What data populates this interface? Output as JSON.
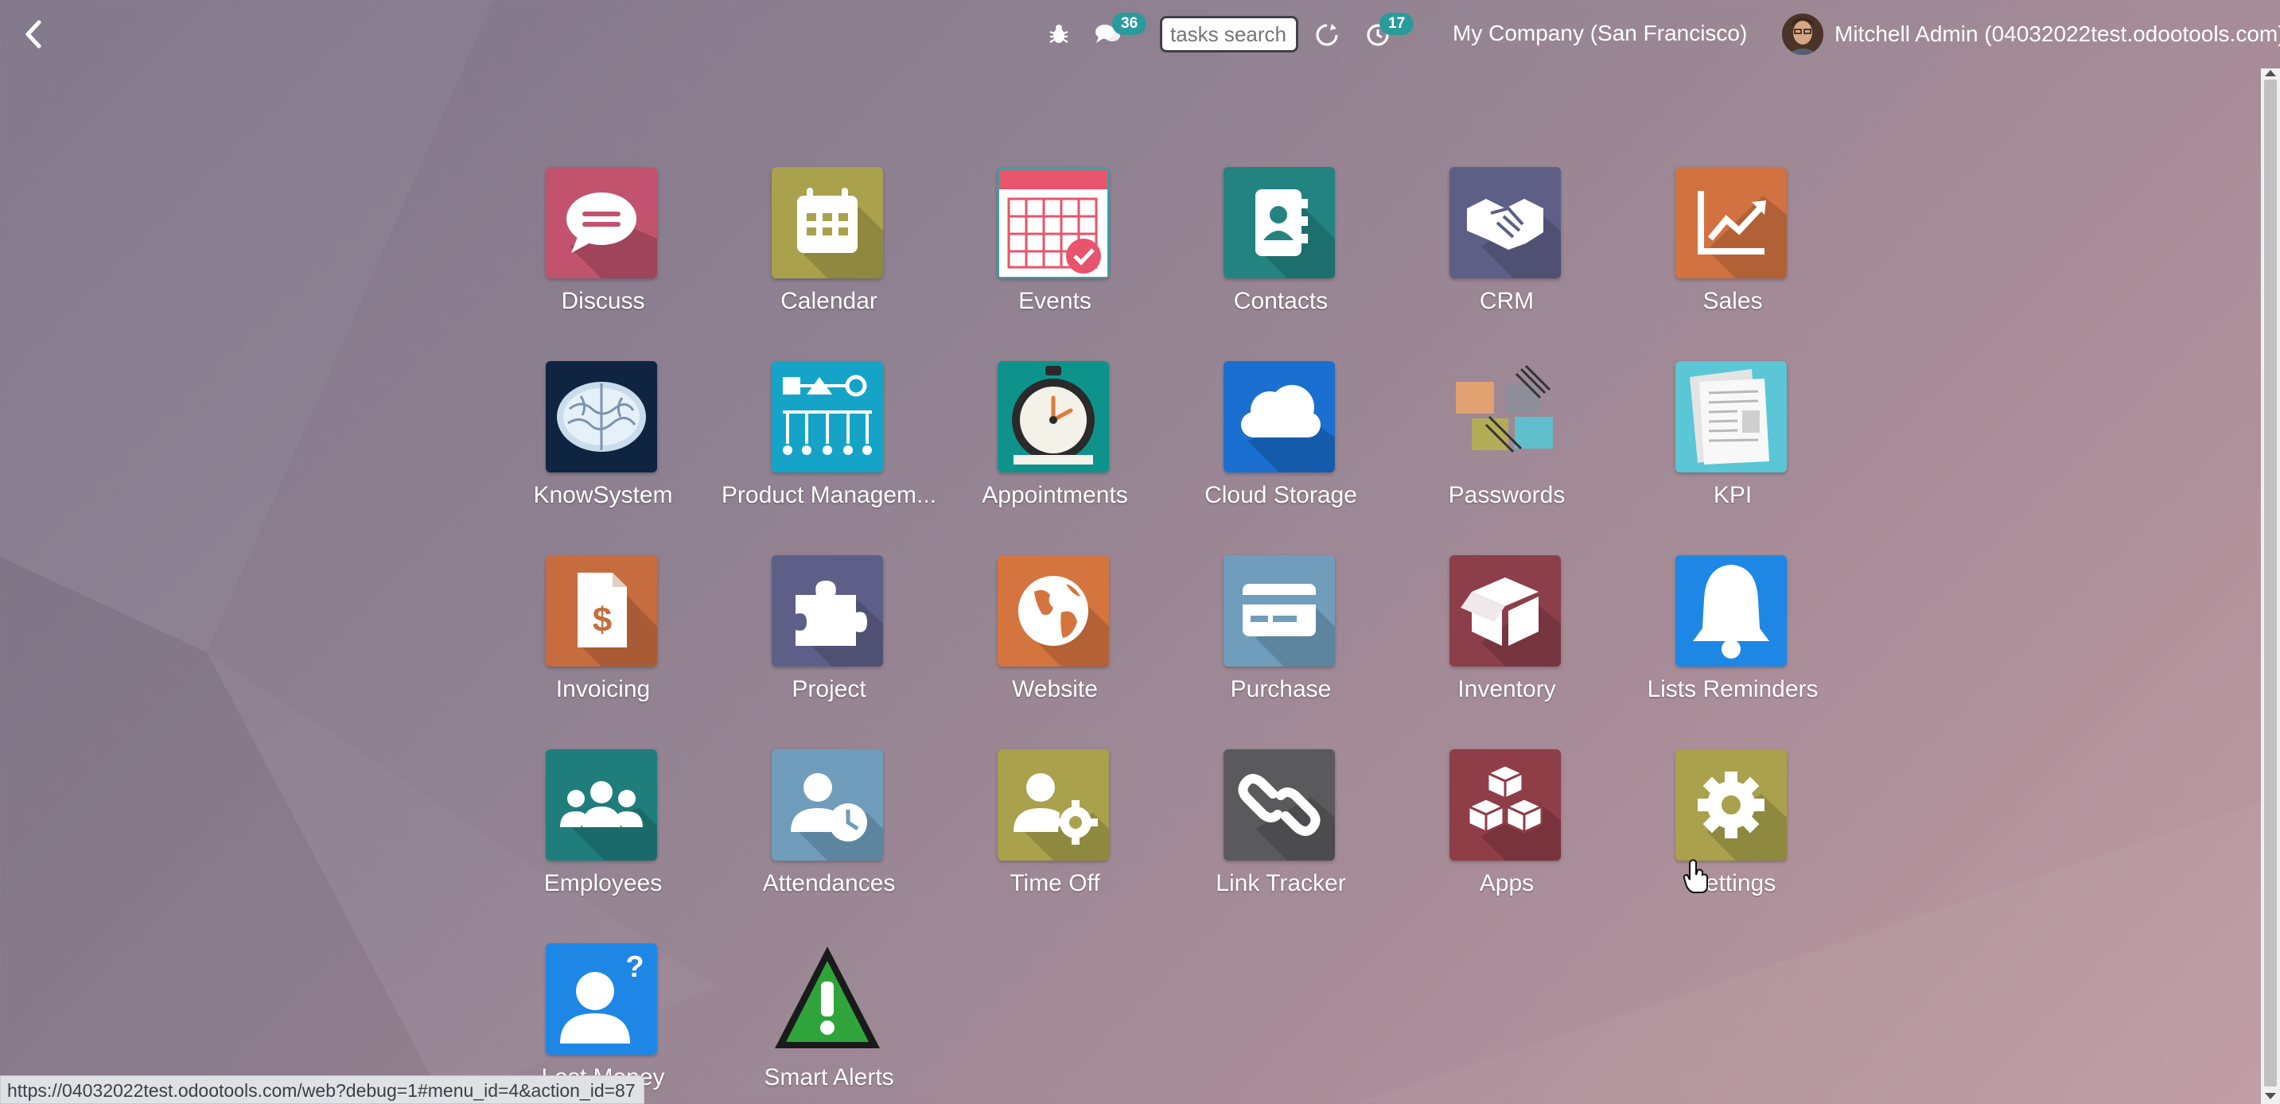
{
  "topbar": {
    "messages_badge": "36",
    "search_placeholder": "tasks search",
    "activities_badge": "17",
    "company": "My Company (San Francisco)",
    "user": "Mitchell Admin (04032022test.odootools.com)"
  },
  "apps": [
    {
      "label": "Discuss",
      "name": "discuss",
      "color": "#c2536e"
    },
    {
      "label": "Calendar",
      "name": "calendar",
      "color": "#a9a14c"
    },
    {
      "label": "Events",
      "name": "events",
      "color": "#32a7a3"
    },
    {
      "label": "Contacts",
      "name": "contacts",
      "color": "#238381"
    },
    {
      "label": "CRM",
      "name": "crm",
      "color": "#5e5f86"
    },
    {
      "label": "Sales",
      "name": "sales",
      "color": "#d27241"
    },
    {
      "label": "KnowSystem",
      "name": "knowsystem",
      "color": "#0f2440"
    },
    {
      "label": "Product Managem...",
      "name": "product-management",
      "color": "#15a4c7"
    },
    {
      "label": "Appointments",
      "name": "appointments",
      "color": "#0e938c"
    },
    {
      "label": "Cloud Storage",
      "name": "cloud-storage",
      "color": "#1a6fd1"
    },
    {
      "label": "Passwords",
      "name": "passwords",
      "color": "transparent"
    },
    {
      "label": "KPI",
      "name": "kpi",
      "color": "#5ac6d6"
    },
    {
      "label": "Invoicing",
      "name": "invoicing",
      "color": "#c66c3f"
    },
    {
      "label": "Project",
      "name": "project",
      "color": "#5d5f88"
    },
    {
      "label": "Website",
      "name": "website",
      "color": "#d4743f"
    },
    {
      "label": "Purchase",
      "name": "purchase",
      "color": "#6f9dbb"
    },
    {
      "label": "Inventory",
      "name": "inventory",
      "color": "#8c3f4b"
    },
    {
      "label": "Lists Reminders",
      "name": "lists-reminders",
      "color": "#1e87e5"
    },
    {
      "label": "Employees",
      "name": "employees",
      "color": "#1f7d7c"
    },
    {
      "label": "Attendances",
      "name": "attendances",
      "color": "#6f9dbb"
    },
    {
      "label": "Time Off",
      "name": "time-off",
      "color": "#a9a14c"
    },
    {
      "label": "Link Tracker",
      "name": "link-tracker",
      "color": "#5a5a5d"
    },
    {
      "label": "Apps",
      "name": "apps",
      "color": "#8f3d47"
    },
    {
      "label": "Settings",
      "name": "settings",
      "color": "#a9a14c"
    },
    {
      "label": "Lost Money",
      "name": "lost-money",
      "color": "#1e87e5"
    },
    {
      "label": "Smart Alerts",
      "name": "smart-alerts",
      "color": "transparent"
    }
  ],
  "statusbar": {
    "url": "https://04032022test.odootools.com/web?debug=1#menu_id=4&action_id=87"
  }
}
